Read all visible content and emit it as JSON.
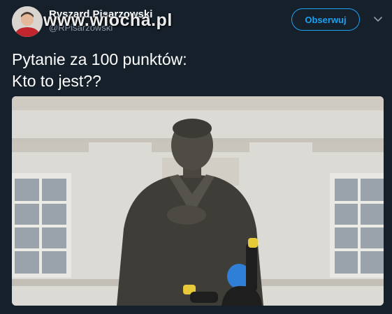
{
  "tweet": {
    "author": {
      "display_name": "Ryszard Pisarzowski",
      "handle": "@RPisarzowski",
      "avatar_icon": "avatar-photo"
    },
    "watermark": "www.wiocha.pl",
    "follow_label": "Obserwuj",
    "more_icon": "chevron-down-icon",
    "text_lines": [
      "Pytanie za 100 punktów:",
      "Kto to jest??"
    ],
    "media": {
      "type": "photo"
    }
  },
  "colors": {
    "background": "#15202b",
    "accent": "#1da1f2",
    "secondary_text": "#8899a6"
  }
}
